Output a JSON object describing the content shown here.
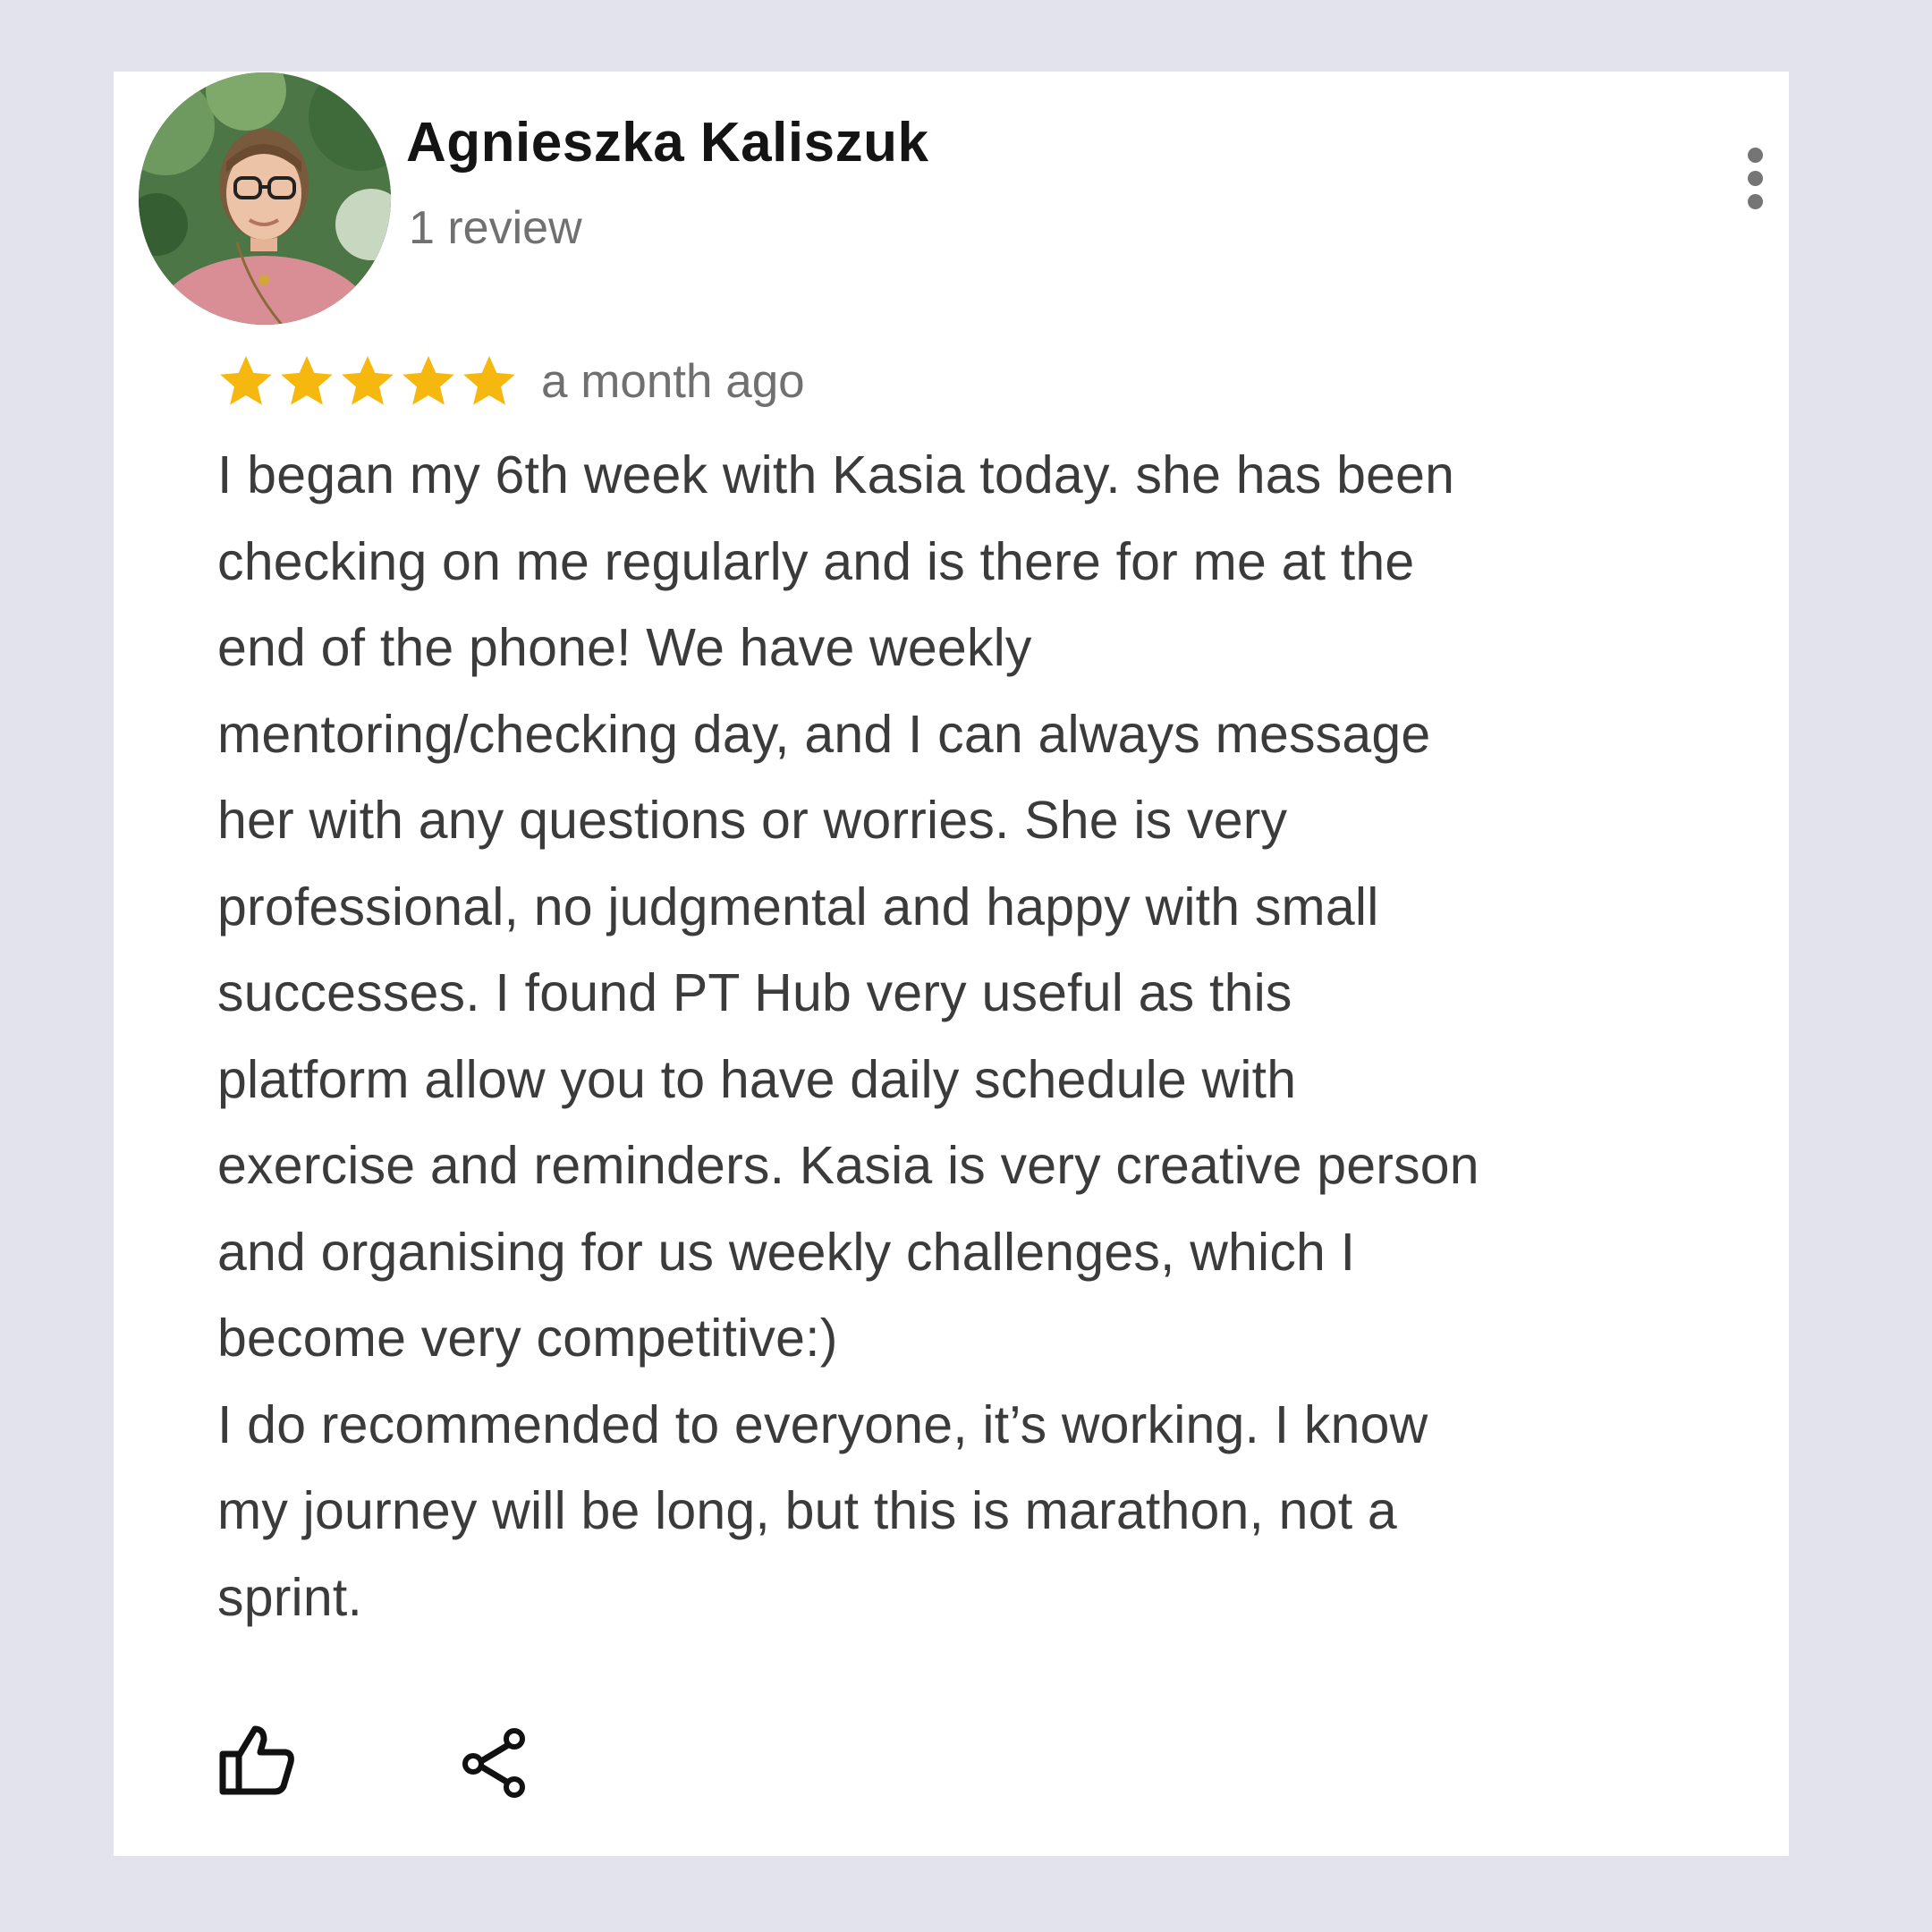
{
  "review": {
    "author_name": "Agnieszka Kaliszuk",
    "review_count": "1 review",
    "rating": 5,
    "rating_max": 5,
    "star_color": "#f6b70e",
    "date": "a month ago",
    "text_lines": [
      "I began my 6th week with Kasia today. she has been",
      "checking on me regularly and is there for me at the",
      "end of the phone! We have weekly",
      "mentoring/checking day, and I can always message",
      "her with any questions or worries. She is very",
      "professional, no judgmental and happy with small",
      "successes.  I found PT Hub very useful as this",
      "platform allow you to have daily schedule with",
      "exercise and reminders. Kasia is very creative person",
      "and organising for us weekly challenges, which I",
      "become very competitive:)",
      "I do recommended to everyone, it’s working. I know",
      "my journey will be long, but this is marathon, not a",
      "sprint."
    ]
  },
  "icons": {
    "avatar": "profile-photo",
    "more": "more-vertical-icon",
    "like": "thumbs-up-icon",
    "share": "share-icon"
  }
}
